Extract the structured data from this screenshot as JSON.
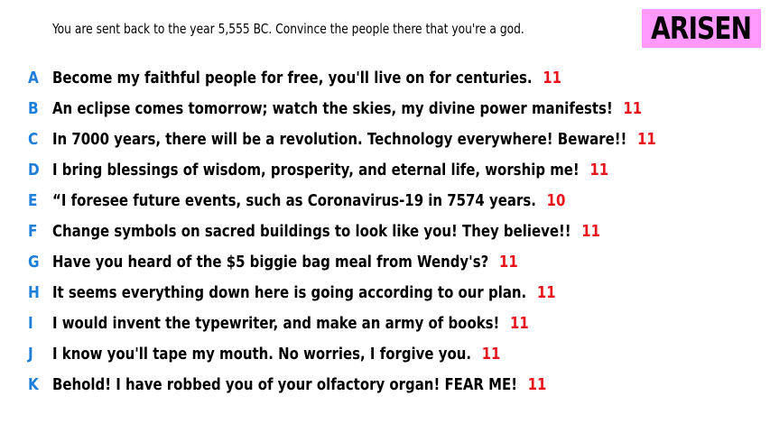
{
  "prompt": "You are sent back to the year 5,555 BC. Convince the people there that you're a god.",
  "badge": {
    "label": "ARISEN",
    "background": "#ff99ff"
  },
  "colors": {
    "letter": "#1e7fd8",
    "score": "#e8141b",
    "text": "#000000"
  },
  "answers": [
    {
      "letter": "A",
      "text": "Become my faithful people for free, you'll live on for centuries.",
      "score": "11"
    },
    {
      "letter": "B",
      "text": "An eclipse comes tomorrow; watch the skies, my divine power manifests!",
      "score": "11"
    },
    {
      "letter": "C",
      "text": "In 7000 years, there will be a revolution. Technology everywhere! Beware!!",
      "score": "11"
    },
    {
      "letter": "D",
      "text": "I bring blessings of wisdom, prosperity, and eternal life, worship me!",
      "score": "11"
    },
    {
      "letter": "E",
      "text": "“I foresee future events, such as Coronavirus-19 in 7574 years.",
      "score": "10"
    },
    {
      "letter": "F",
      "text": "Change symbols on sacred buildings to look like you! They believe!!",
      "score": "11"
    },
    {
      "letter": "G",
      "text": "Have you heard of the $5 biggie bag meal from Wendy's?",
      "score": "11"
    },
    {
      "letter": "H",
      "text": "It seems everything down here is going according to our plan.",
      "score": "11"
    },
    {
      "letter": "I",
      "text": "I would invent the typewriter, and make an army of books!",
      "score": "11"
    },
    {
      "letter": "J",
      "text": "I know you'll tape my mouth. No worries, I forgive you.",
      "score": "11"
    },
    {
      "letter": "K",
      "text": "Behold! I have robbed you of your olfactory organ! FEAR ME!",
      "score": "11"
    }
  ]
}
